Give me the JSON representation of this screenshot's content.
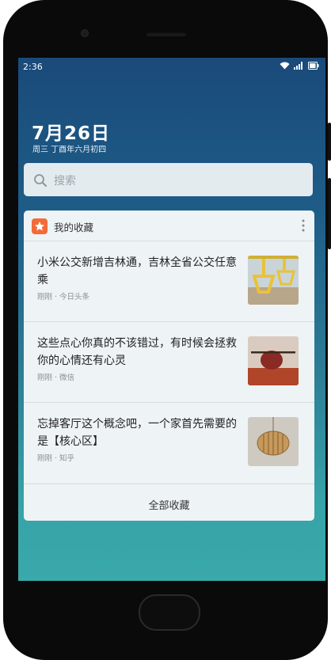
{
  "status_bar": {
    "time": "2:36"
  },
  "date": {
    "main": "7月26日",
    "lunar": "周三 丁酉年六月初四"
  },
  "search": {
    "placeholder": "搜索"
  },
  "favorites": {
    "title": "我的收藏",
    "items": [
      {
        "title": "小米公交新增吉林通，吉林全省公交任意乘",
        "meta": "刚刚 · 今日头条"
      },
      {
        "title": "这些点心你真的不该错过，有时候会拯救你的心情还有心灵",
        "meta": "刚刚 · 微信"
      },
      {
        "title": "忘掉客厅这个概念吧，一个家首先需要的是【核心区】",
        "meta": "刚刚 · 知乎"
      }
    ],
    "footer": "全部收藏"
  },
  "colors": {
    "accent": "#f26c3a",
    "card_bg": "#eef3f5",
    "search_bg": "#e4ebef"
  },
  "icons": [
    "wifi-icon",
    "signal-icon",
    "battery-icon",
    "search-icon",
    "star-icon",
    "more-vertical-icon"
  ]
}
